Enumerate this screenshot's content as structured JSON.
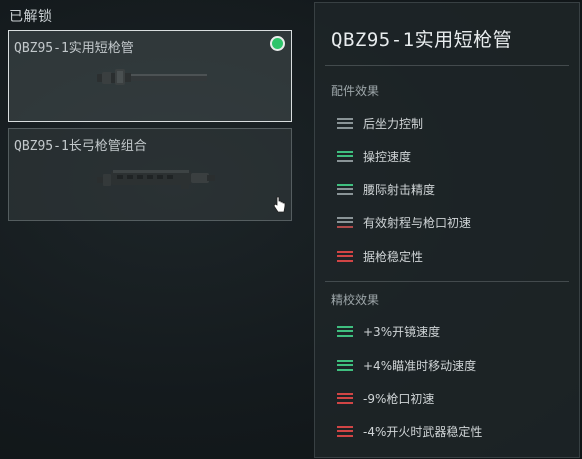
{
  "left": {
    "section_title": "已解锁",
    "cards": [
      {
        "label": "QBZ95-1实用短枪管",
        "selected": true,
        "equipped": true
      },
      {
        "label": "QBZ95-1长弓枪管组合",
        "selected": false,
        "equipped": false
      }
    ]
  },
  "panel": {
    "title": "QBZ95-1实用短枪管",
    "effects_heading": "配件效果",
    "effects": [
      {
        "text": "后坐力控制",
        "icon": "neutral-bars-icon",
        "color": "#8a9497"
      },
      {
        "text": "操控速度",
        "icon": "positive-bars-icon",
        "color": "#3fbf7f"
      },
      {
        "text": "腰际射击精度",
        "icon": "positive-bars-icon",
        "color": "#3fbf7f"
      },
      {
        "text": "有效射程与枪口初速",
        "icon": "neutral-bars-icon",
        "color": "#b04a4a"
      },
      {
        "text": "据枪稳定性",
        "icon": "negative-bars-icon",
        "color": "#d14545"
      }
    ],
    "calibration_heading": "精校效果",
    "calibration": [
      {
        "text": "+3%开镜速度",
        "icon": "positive-bars-icon",
        "color": "#3fbf7f"
      },
      {
        "text": "+4%瞄准时移动速度",
        "icon": "positive-bars-icon",
        "color": "#3fbf7f"
      },
      {
        "text": "-9%枪口初速",
        "icon": "negative-bars-icon",
        "color": "#d14545"
      },
      {
        "text": "-4%开火时武器稳定性",
        "icon": "negative-bars-icon",
        "color": "#d14545"
      }
    ]
  }
}
